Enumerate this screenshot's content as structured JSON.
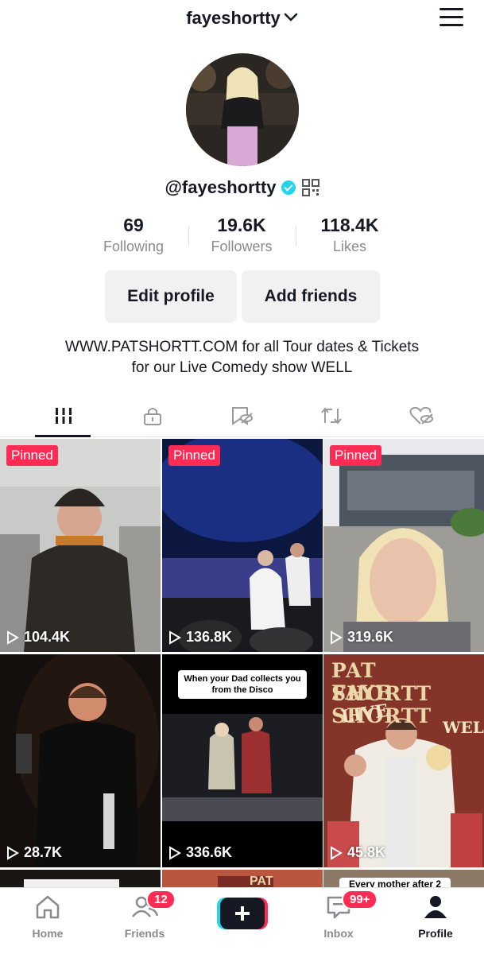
{
  "header": {
    "username": "fayeshortty"
  },
  "profile": {
    "handle": "@fayeshortty"
  },
  "stats": [
    {
      "value": "69",
      "label": "Following"
    },
    {
      "value": "19.6K",
      "label": "Followers"
    },
    {
      "value": "118.4K",
      "label": "Likes"
    }
  ],
  "buttons": {
    "edit": "Edit profile",
    "add": "Add friends"
  },
  "bio": {
    "line1": "WWW.PATSHORTT.COM for all Tour dates & Tickets",
    "line2": "for our Live Comedy show WELL"
  },
  "tabs": [
    "videos-grid-icon",
    "private-lock-icon",
    "reposts-icon",
    "favorites-icon",
    "liked-icon"
  ],
  "videos": [
    {
      "pinned": "Pinned",
      "views": "104.4K"
    },
    {
      "pinned": "Pinned",
      "views": "136.8K"
    },
    {
      "pinned": "Pinned",
      "views": "319.6K"
    },
    {
      "views": "28.7K"
    },
    {
      "views": "336.6K",
      "caption1": "When your Dad collects you",
      "caption2": "from the Disco"
    },
    {
      "views": "45.8K",
      "poster1": "PAT SHORTT",
      "poster2": "FAYE SHORTT",
      "poster3": "LIVE",
      "poster4": "WELL"
    },
    {},
    {
      "poster": "PAT"
    },
    {
      "caption": "Every mother after 2"
    }
  ],
  "nav": {
    "home": "Home",
    "friends": "Friends",
    "friends_badge": "12",
    "inbox": "Inbox",
    "inbox_badge": "99+",
    "profile": "Profile"
  },
  "colors": {
    "accent": "#fe2c55",
    "verified": "#20d5ec",
    "muted": "#8a8b91"
  }
}
